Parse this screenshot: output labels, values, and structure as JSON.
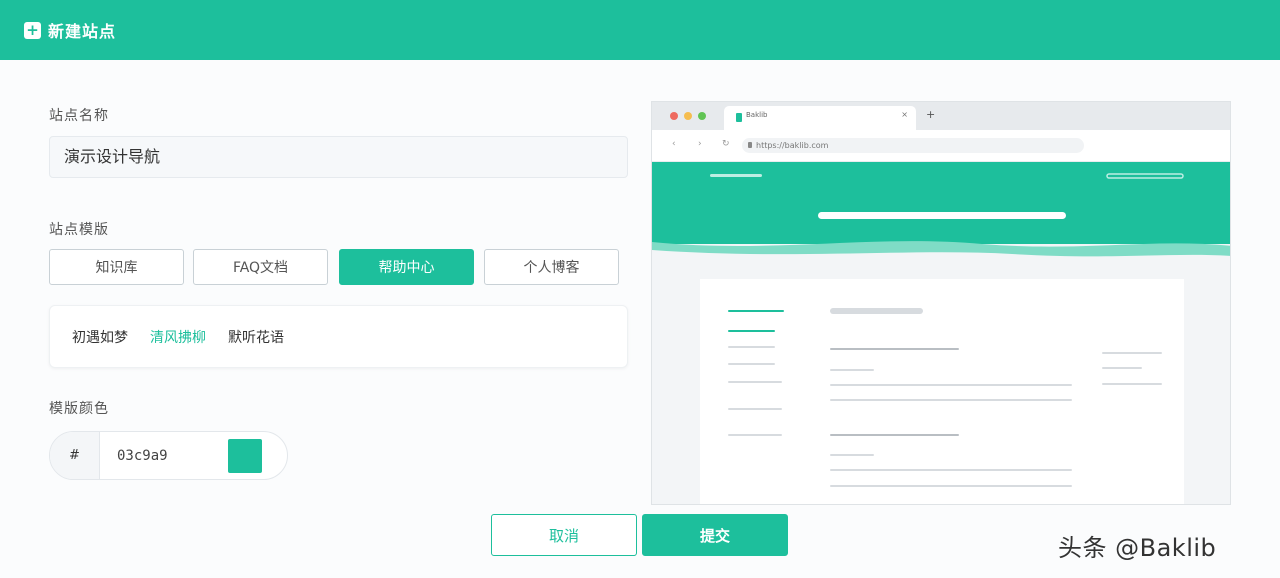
{
  "header": {
    "title": "新建站点",
    "icon": "plus-square-icon"
  },
  "site_name": {
    "label": "站点名称",
    "value": "演示设计导航"
  },
  "template": {
    "label": "站点模版",
    "options": [
      "知识库",
      "FAQ文档",
      "帮助中心",
      "个人博客"
    ],
    "selected": "帮助中心"
  },
  "theme": {
    "options": [
      "初遇如梦",
      "清风拂柳",
      "默听花语"
    ],
    "selected": "清风拂柳"
  },
  "color": {
    "label": "模版颜色",
    "prefix": "#",
    "value": "03c9a9",
    "swatch": "#1dbf9c"
  },
  "preview": {
    "tab_title": "Baklib",
    "url": "https://baklib.com"
  },
  "actions": {
    "cancel": "取消",
    "submit": "提交"
  },
  "watermark": "头条 @Baklib",
  "colors": {
    "accent": "#1dbf9c"
  }
}
